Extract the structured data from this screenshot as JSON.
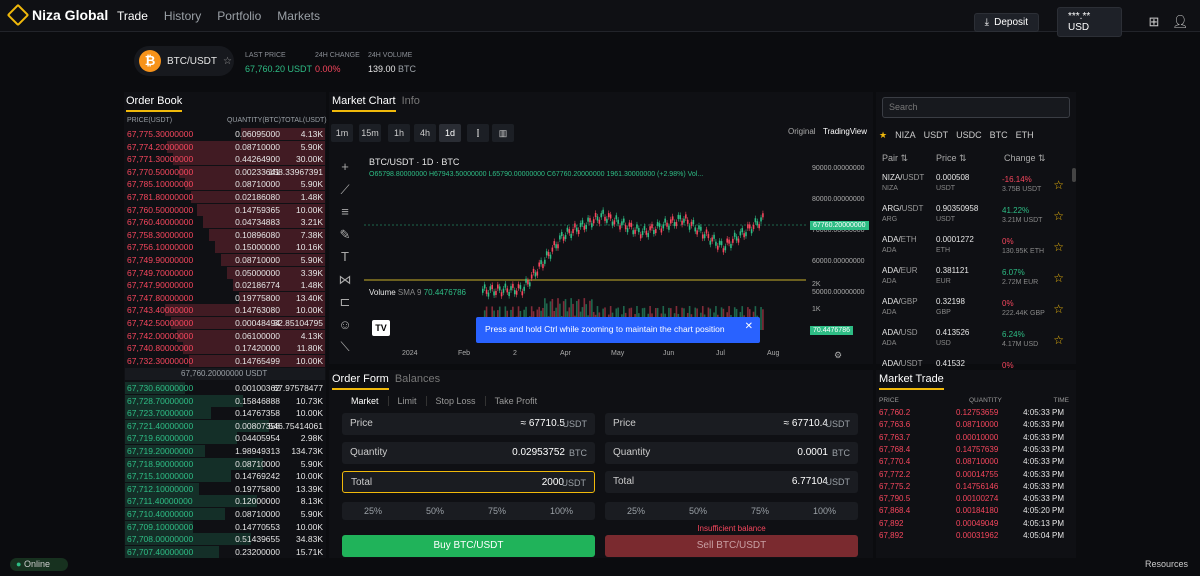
{
  "app": {
    "name": "Niza Global",
    "nav": [
      "Trade",
      "History",
      "Portfolio",
      "Markets"
    ],
    "deposit": "Deposit",
    "balance": "***.** USD"
  },
  "ticker": {
    "pair": "BTC/USDT",
    "last_price_label": "LAST PRICE",
    "last_price": "67,760.20 USDT",
    "change_label": "24H CHANGE",
    "change": "0.00%",
    "volume_label": "24H VOLUME",
    "volume": "139.00",
    "volume_unit": "BTC"
  },
  "orderbook": {
    "title": "Order Book",
    "headers": [
      "PRICE(USDT)",
      "QUANTITY(BTC)",
      "TOTAL(USDT)"
    ],
    "asks": [
      [
        "67,775.30000000",
        "0.06095000",
        "4.13K"
      ],
      [
        "67,774.20000000",
        "0.08710000",
        "5.90K"
      ],
      [
        "67,771.30000000",
        "0.44264900",
        "30.00K"
      ],
      [
        "67,770.50000000",
        "0.00233641",
        "158.33967391"
      ],
      [
        "67,785.10000000",
        "0.08710000",
        "5.90K"
      ],
      [
        "67,781.80000000",
        "0.02186080",
        "1.48K"
      ],
      [
        "67,760.50000000",
        "0.14759365",
        "10.00K"
      ],
      [
        "67,760.40000000",
        "0.04734883",
        "3.21K"
      ],
      [
        "67,758.30000000",
        "0.10896080",
        "7.38K"
      ],
      [
        "67,756.10000000",
        "0.15000000",
        "10.16K"
      ],
      [
        "67,749.90000000",
        "0.08710000",
        "5.90K"
      ],
      [
        "67,749.70000000",
        "0.05000000",
        "3.39K"
      ],
      [
        "67,747.90000000",
        "0.02186774",
        "1.48K"
      ],
      [
        "67,747.80000000",
        "0.19775800",
        "13.40K"
      ],
      [
        "67,743.40000000",
        "0.14763080",
        "10.00K"
      ],
      [
        "67,742.50000000",
        "0.00048494",
        "32.85104795"
      ],
      [
        "67,742.00000000",
        "0.06100000",
        "4.13K"
      ],
      [
        "67,740.80000000",
        "0.17420000",
        "11.80K"
      ],
      [
        "67,732.30000000",
        "0.14765499",
        "10.00K"
      ]
    ],
    "mid": "67,760.20000000 USDT",
    "bids": [
      [
        "67,730.60000000",
        "0.00100362",
        "67.97578477"
      ],
      [
        "67,728.70000000",
        "0.15846888",
        "10.73K"
      ],
      [
        "67,723.70000000",
        "0.14767358",
        "10.00K"
      ],
      [
        "67,721.40000000",
        "0.00807358",
        "546.75414061"
      ],
      [
        "67,719.60000000",
        "0.04405954",
        "2.98K"
      ],
      [
        "67,719.20000000",
        "1.98949313",
        "134.73K"
      ],
      [
        "67,718.90000000",
        "0.08710000",
        "5.90K"
      ],
      [
        "67,715.10000000",
        "0.14769242",
        "10.00K"
      ],
      [
        "67,712.10000000",
        "0.19775800",
        "13.39K"
      ],
      [
        "67,711.40000000",
        "0.12000000",
        "8.13K"
      ],
      [
        "67,710.40000000",
        "0.08710000",
        "5.90K"
      ],
      [
        "67,709.10000000",
        "0.14770553",
        "10.00K"
      ],
      [
        "67,708.00000000",
        "0.51439655",
        "34.83K"
      ],
      [
        "67,707.40000000",
        "0.23200000",
        "15.71K"
      ]
    ]
  },
  "chart": {
    "tabs": [
      "Market Chart",
      "Info"
    ],
    "timeframes": [
      "1m",
      "15m",
      "1h",
      "4h",
      "1d"
    ],
    "views": [
      "Original",
      "TradingView"
    ],
    "symbol": "BTC/USDT · 1D · BTC",
    "ohlc": "O65798.80000000 H67943.50000000 L65790.00000000 C67760.20000000 1961.30000000 (+2.98%) Vol...",
    "volume_label": "Volume",
    "sma_label": "SMA 9",
    "sma_value": "70.4476786",
    "price_axis": [
      "90000.00000000",
      "80000.00000000",
      "70000.00000000",
      "60000.00000000",
      "50000.00000000"
    ],
    "last_tag": "67760.20000000",
    "vol_axis": [
      "2K",
      "1K"
    ],
    "vol_tag": "70.4476786",
    "time_axis": [
      "2024",
      "Feb",
      "2",
      "Apr",
      "May",
      "Jun",
      "Jul",
      "Aug"
    ],
    "toast": "Press and hold Ctrl while zooming to maintain the chart position"
  },
  "chart_data": {
    "type": "line",
    "title": "BTC/USDT · 1D · BTC",
    "x": [
      "2024",
      "Feb",
      "2",
      "Apr",
      "May",
      "Jun",
      "Jul",
      "Aug"
    ],
    "series": [
      {
        "name": "BTC/USDT",
        "values": [
          43000,
          43500,
          62000,
          69000,
          63000,
          68000,
          58000,
          67760
        ]
      }
    ],
    "ylim": [
      45000,
      90000
    ]
  },
  "order": {
    "tabs": [
      "Order Form",
      "Balances"
    ],
    "types": [
      "Market",
      "Limit",
      "Stop Loss",
      "Take Profit"
    ],
    "buy": {
      "price_label": "Price",
      "price": "≈ 67710.5",
      "qty_label": "Quantity",
      "qty": "0.02953752",
      "total_label": "Total",
      "total": "2000",
      "unit": "USDT",
      "qunit": "BTC",
      "btn": "Buy BTC/USDT"
    },
    "sell": {
      "price_label": "Price",
      "price": "≈ 67710.4",
      "qty_label": "Quantity",
      "qty": "0.0001",
      "total_label": "Total",
      "total": "6.77104",
      "unit": "USDT",
      "qunit": "BTC",
      "btn": "Sell BTC/USDT",
      "warn": "Insufficient balance"
    },
    "pcts": [
      "25%",
      "50%",
      "75%",
      "100%"
    ]
  },
  "markets": {
    "search_placeholder": "Search",
    "filters": [
      "NIZA",
      "USDT",
      "USDC",
      "BTC",
      "ETH"
    ],
    "headers": [
      "Pair ⇅",
      "Price ⇅",
      "Change ⇅"
    ],
    "rows": [
      [
        "NIZA/",
        "USDT",
        "NIZA",
        "0.000508",
        "USDT",
        "-16.14%",
        "3.75B USDT",
        "red"
      ],
      [
        "ARG/",
        "USDT",
        "ARG",
        "0.90350958",
        "USDT",
        "41.22%",
        "3.21M USDT",
        "green"
      ],
      [
        "ADA/",
        "ETH",
        "ADA",
        "0.0001272",
        "ETH",
        "0%",
        "130.95K ETH",
        "red"
      ],
      [
        "ADA/",
        "EUR",
        "ADA",
        "0.381121",
        "EUR",
        "6.07%",
        "2.72M EUR",
        "green"
      ],
      [
        "ADA/",
        "GBP",
        "ADA",
        "0.32198",
        "GBP",
        "0%",
        "222.44K GBP",
        "red"
      ],
      [
        "ADA/",
        "USD",
        "ADA",
        "0.413526",
        "USD",
        "6.24%",
        "4.17M USD",
        "green"
      ],
      [
        "ADA/",
        "USDT",
        "ADA",
        "0.41532",
        "USDT",
        "0%",
        "",
        "red"
      ]
    ]
  },
  "trades": {
    "title": "Market Trade",
    "headers": [
      "PRICE",
      "QUANTITY",
      "TIME"
    ],
    "rows": [
      [
        "67,760.2",
        "0.12753659",
        "4:05:33 PM"
      ],
      [
        "67,763.6",
        "0.08710000",
        "4:05:33 PM"
      ],
      [
        "67,763.7",
        "0.00010000",
        "4:05:33 PM"
      ],
      [
        "67,768.4",
        "0.14757639",
        "4:05:33 PM"
      ],
      [
        "67,770.4",
        "0.08710000",
        "4:05:33 PM"
      ],
      [
        "67,772.2",
        "0.00014755",
        "4:05:33 PM"
      ],
      [
        "67,775.2",
        "0.14756146",
        "4:05:33 PM"
      ],
      [
        "67,790.5",
        "0.00100274",
        "4:05:33 PM"
      ],
      [
        "67,868.4",
        "0.00184180",
        "4:05:20 PM"
      ],
      [
        "67,892",
        "0.00049049",
        "4:05:13 PM"
      ],
      [
        "67,892",
        "0.00031962",
        "4:05:04 PM"
      ]
    ]
  },
  "footer": {
    "status": "Online",
    "resources": "Resources"
  }
}
